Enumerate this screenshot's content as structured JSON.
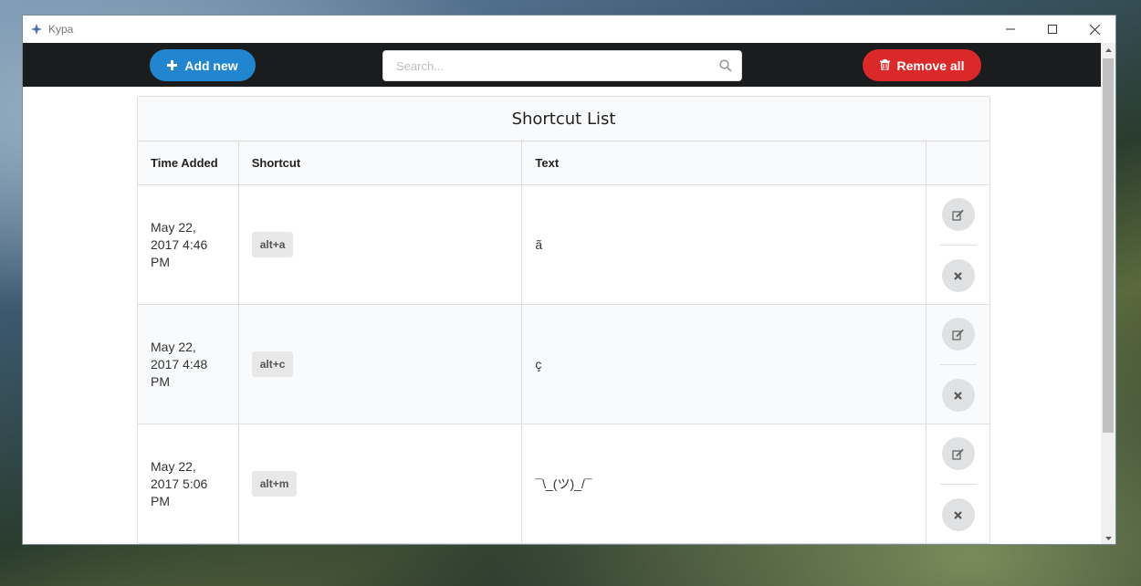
{
  "window": {
    "title": "Kypa"
  },
  "toolbar": {
    "add_label": "Add new",
    "search_placeholder": "Search...",
    "remove_all_label": "Remove all"
  },
  "table": {
    "title": "Shortcut List",
    "columns": [
      "Time Added",
      "Shortcut",
      "Text",
      ""
    ],
    "rows": [
      {
        "time_line1": "May 22,",
        "time_line2": "2017 4:46",
        "time_line3": "PM",
        "shortcut": "alt+a",
        "text": "ã"
      },
      {
        "time_line1": "May 22,",
        "time_line2": "2017 4:48",
        "time_line3": "PM",
        "shortcut": "alt+c",
        "text": "ç"
      },
      {
        "time_line1": "May 22,",
        "time_line2": "2017 5:06",
        "time_line3": "PM",
        "shortcut": "alt+m",
        "text": "¯\\_(ツ)_/¯"
      }
    ]
  },
  "icons": {
    "app": "kypa-logo-icon",
    "add": "plus-icon",
    "search": "search-icon",
    "remove_all": "trash-icon",
    "edit": "edit-icon",
    "delete": "close-icon"
  },
  "colors": {
    "toolbar_bg": "#1b1c1d",
    "add_button": "#2185d0",
    "remove_button": "#db2828"
  }
}
